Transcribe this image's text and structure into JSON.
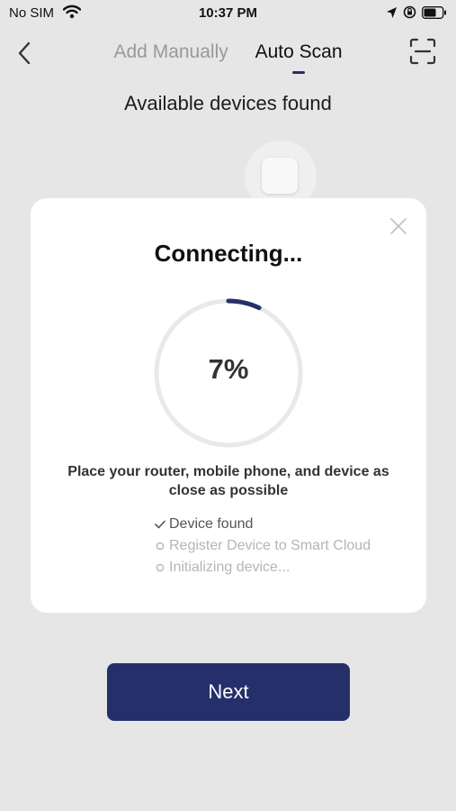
{
  "status_bar": {
    "carrier": "No SIM",
    "time": "10:37 PM"
  },
  "nav": {
    "tabs": [
      {
        "label": "Add Manually",
        "active": false
      },
      {
        "label": "Auto Scan",
        "active": true
      }
    ]
  },
  "subtitle": "Available devices found",
  "modal": {
    "title": "Connecting...",
    "progress_percent": 7,
    "progress_label": "7%",
    "hint": "Place your router, mobile phone, and device as close as possible",
    "steps": [
      {
        "label": "Device found",
        "status": "done"
      },
      {
        "label": "Register Device to Smart Cloud",
        "status": "pending"
      },
      {
        "label": "Initializing device...",
        "status": "pending"
      }
    ]
  },
  "next_button": "Next",
  "colors": {
    "accent": "#25306a",
    "background": "#e6e6e6",
    "ring_track": "#e9e9e9"
  }
}
